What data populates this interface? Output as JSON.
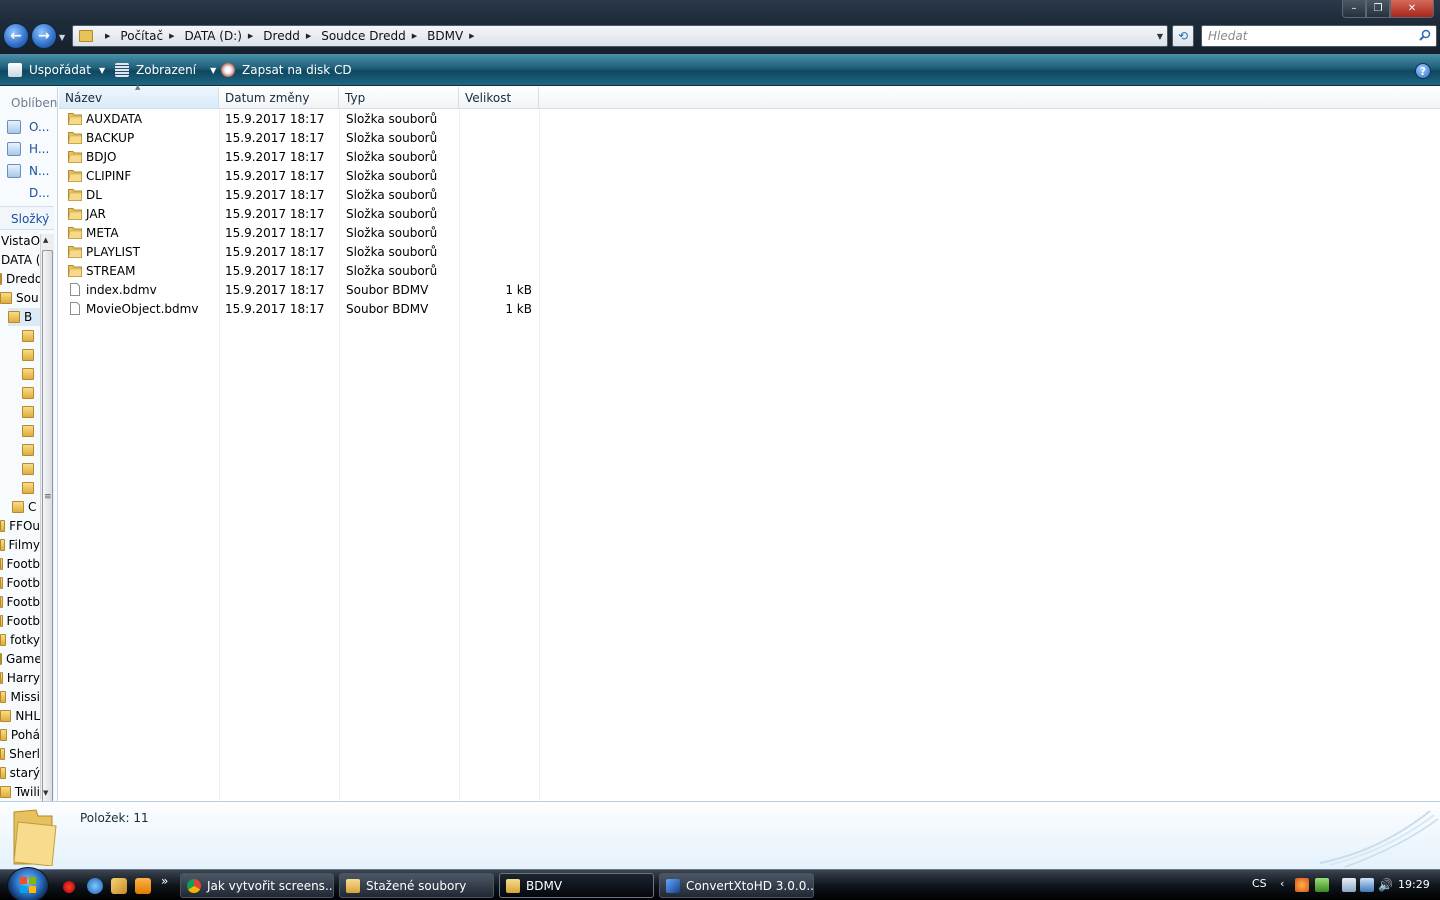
{
  "window": {
    "minimize_label": "–",
    "maximize_label": "❐",
    "close_label": "✕"
  },
  "address": {
    "crumbs": [
      "Počítač",
      "DATA (D:)",
      "Dredd",
      "Soudce Dredd",
      "BDMV"
    ]
  },
  "search": {
    "placeholder": "Hledat"
  },
  "toolbar": {
    "organize_label": "Uspořádat",
    "views_label": "Zobrazení",
    "burn_label": "Zapsat na disk CD"
  },
  "navpane": {
    "favorites_heading": "Oblíbené",
    "favorites": [
      "O...",
      "H...",
      "N...",
      "D..."
    ],
    "folders_label": "Složky",
    "tree": [
      "VistaOS",
      "DATA (",
      "Dredd",
      "Sou",
      "B",
      "",
      "",
      "",
      "",
      "",
      "",
      "",
      "",
      "",
      "C",
      "FFOu",
      "Filmy",
      "Footb",
      "Footb",
      "Footb",
      "Footb",
      "fotky",
      "Game",
      "Harry",
      "Missi",
      "NHL",
      "Pohá",
      "Sherl",
      "starý",
      "Twili"
    ]
  },
  "columns": {
    "name": "Název",
    "date": "Datum změny",
    "type": "Typ",
    "size": "Velikost"
  },
  "files": [
    {
      "name": "AUXDATA",
      "date": "15.9.2017 18:17",
      "type": "Složka souborů",
      "size": "",
      "kind": "folder"
    },
    {
      "name": "BACKUP",
      "date": "15.9.2017 18:17",
      "type": "Složka souborů",
      "size": "",
      "kind": "folder"
    },
    {
      "name": "BDJO",
      "date": "15.9.2017 18:17",
      "type": "Složka souborů",
      "size": "",
      "kind": "folder"
    },
    {
      "name": "CLIPINF",
      "date": "15.9.2017 18:17",
      "type": "Složka souborů",
      "size": "",
      "kind": "folder"
    },
    {
      "name": "DL",
      "date": "15.9.2017 18:17",
      "type": "Složka souborů",
      "size": "",
      "kind": "folder"
    },
    {
      "name": "JAR",
      "date": "15.9.2017 18:17",
      "type": "Složka souborů",
      "size": "",
      "kind": "folder"
    },
    {
      "name": "META",
      "date": "15.9.2017 18:17",
      "type": "Složka souborů",
      "size": "",
      "kind": "folder"
    },
    {
      "name": "PLAYLIST",
      "date": "15.9.2017 18:17",
      "type": "Složka souborů",
      "size": "",
      "kind": "folder"
    },
    {
      "name": "STREAM",
      "date": "15.9.2017 18:17",
      "type": "Složka souborů",
      "size": "",
      "kind": "folder"
    },
    {
      "name": "index.bdmv",
      "date": "15.9.2017 18:17",
      "type": "Soubor BDMV",
      "size": "1 kB",
      "kind": "file"
    },
    {
      "name": "MovieObject.bdmv",
      "date": "15.9.2017 18:17",
      "type": "Soubor BDMV",
      "size": "1 kB",
      "kind": "file"
    }
  ],
  "details": {
    "item_count": "Položek: 11"
  },
  "taskbar": {
    "more_label": "»",
    "buttons": [
      "Jak vytvořit screens...",
      "Stažené soubory",
      "BDMV",
      "ConvertXtoHD 3.0.0...."
    ],
    "language": "CS",
    "tray_arrow": "‹",
    "clock": "19:29"
  },
  "colors": {
    "accent": "#1f5f7a",
    "folder": "#e8c35a",
    "link": "#1c4fa0"
  }
}
